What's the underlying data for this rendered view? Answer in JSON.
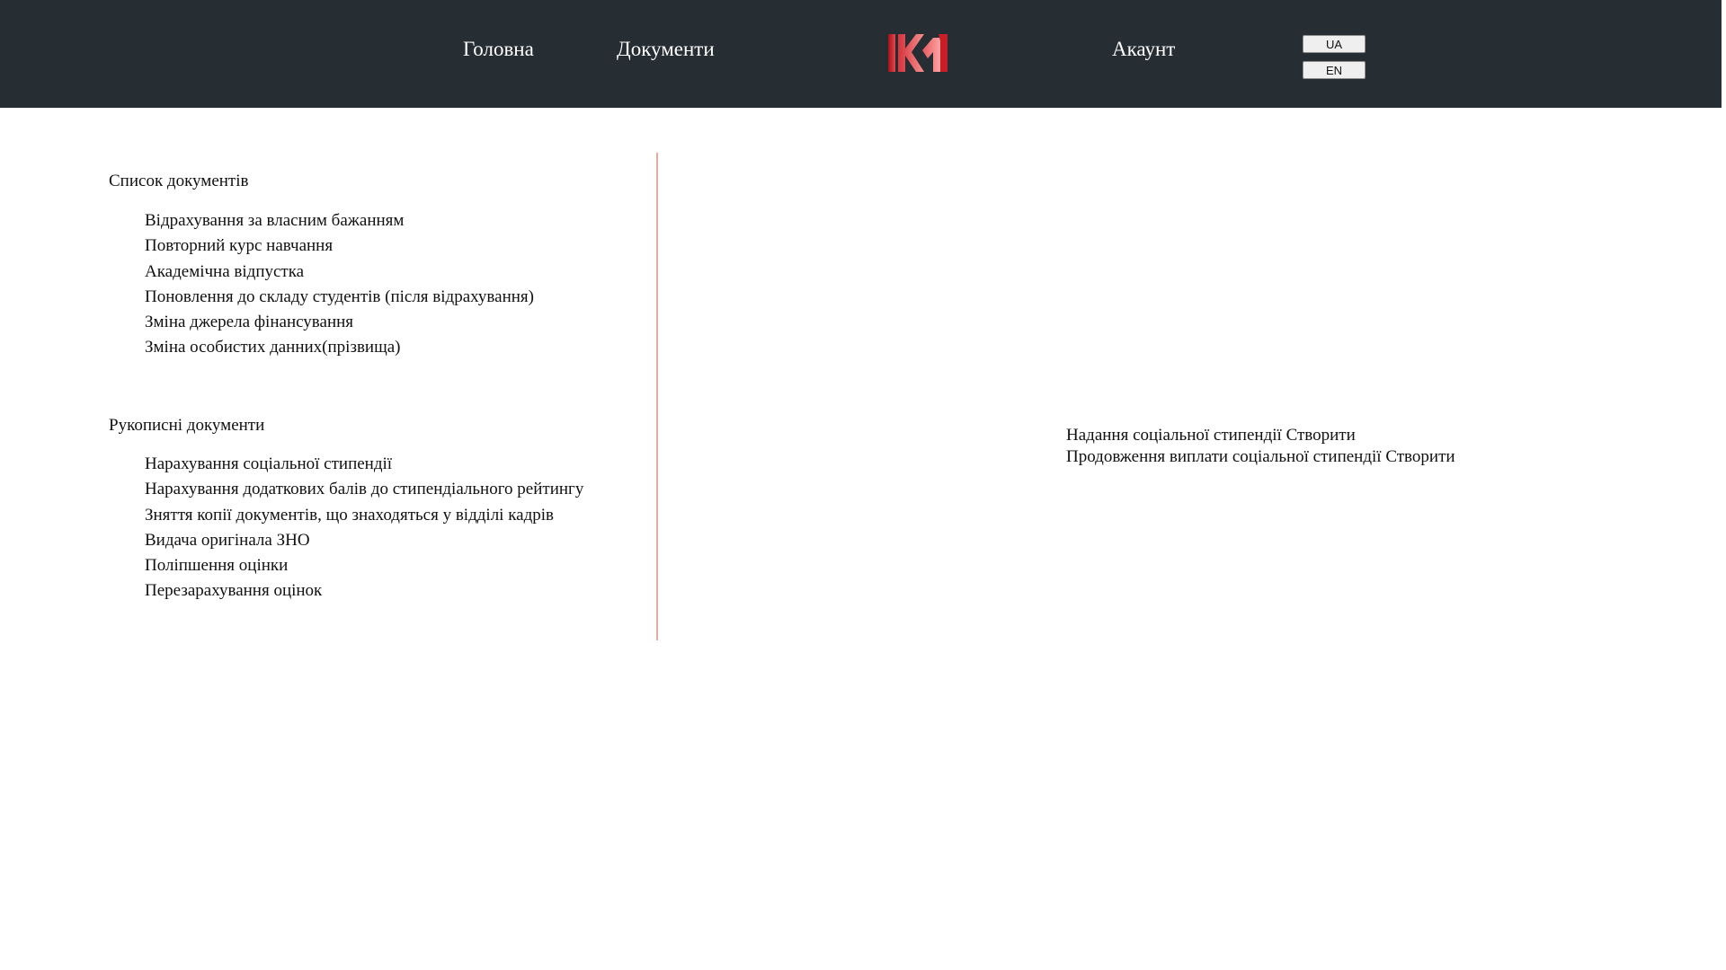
{
  "header": {
    "nav": {
      "home": "Головна",
      "documents": "Документи",
      "account": "Акаунт"
    },
    "logo_icon": "university-logo-icon",
    "languages": [
      "UA",
      "EN"
    ],
    "colors": {
      "bar": "#262d33",
      "logo_dark": "#b3141e",
      "logo_light": "#f07b7b"
    }
  },
  "documents": {
    "title": "Список документів",
    "items": [
      "Відрахування за власним бажанням",
      "Повторний курс навчання",
      "Академічна відпустка",
      "Поновлення до складу студентів (після відрахування)",
      "Зміна джерела фінансування",
      "Зміна особистих данних(прізвища)"
    ]
  },
  "handwritten": {
    "title": "Рукописні документи",
    "items": [
      "Нарахування соціальної стипендії",
      "Нарахування додаткових балів до стипендіального рейтингу",
      "Зняття копії документів, що знаходяться у відділі кадрів",
      "Видача оригінала ЗНО",
      "Поліпшення оцінки",
      "Перезарахування оцінок"
    ]
  },
  "create_panel": {
    "items": [
      {
        "name": "Надання соціальної стипендії",
        "action": "Створити"
      },
      {
        "name": "Продовження виплати соціальної стипендії",
        "action": "Створити"
      }
    ]
  },
  "divider_color": "#e3aca3"
}
